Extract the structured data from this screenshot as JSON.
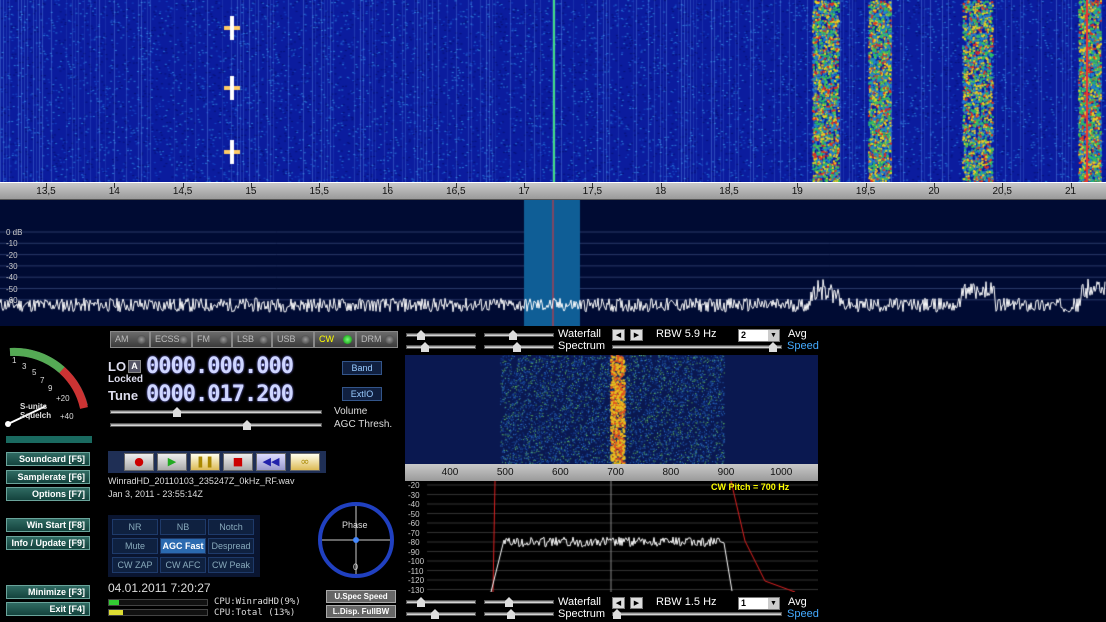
{
  "top_axis": {
    "labels": [
      "13,5",
      "14",
      "14,5",
      "15",
      "15,5",
      "16",
      "16,5",
      "17",
      "17,5",
      "18",
      "18,5",
      "19",
      "19,5",
      "20",
      "20,5",
      "21"
    ]
  },
  "top_spectrum": {
    "db_labels": [
      "0 dB",
      "-10",
      "-20",
      "-30",
      "-40",
      "-50",
      "-60"
    ]
  },
  "modes": [
    {
      "label": "AM",
      "active": false
    },
    {
      "label": "ECSS",
      "active": false
    },
    {
      "label": "FM",
      "active": false
    },
    {
      "label": "LSB",
      "active": false
    },
    {
      "label": "USB",
      "active": false
    },
    {
      "label": "CW",
      "active": true
    },
    {
      "label": "DRM",
      "active": false
    }
  ],
  "lo": {
    "label": "LO",
    "badge": "A",
    "locked": "Locked",
    "value": "0000.000.000"
  },
  "tune": {
    "label": "Tune",
    "value": "0000.017.200"
  },
  "band_button": "Band",
  "extio_button": "ExtIO",
  "volume_label": "Volume",
  "agc_label": "AGC Thresh.",
  "smeter": {
    "scale": [
      "1",
      "3",
      "5",
      "7",
      "9",
      "+20",
      "+40"
    ],
    "caption1": "S-units",
    "caption2": "Squelch"
  },
  "left_buttons": [
    {
      "label": "Soundcard  [F5]"
    },
    {
      "label": "Samplerate  [F6]"
    },
    {
      "label": "Options  [F7]"
    },
    {
      "label": "Win Start  [F8]"
    },
    {
      "label": "Info / Update  [F9]"
    },
    {
      "label": "Minimize  [F3]"
    },
    {
      "label": "Exit  [F4]"
    }
  ],
  "file": {
    "name": "WinradHD_20110103_235247Z_0kHz_RF.wav",
    "date": "Jan 3, 2011 - 23:55:14Z"
  },
  "dsp_buttons": [
    {
      "label": "NR",
      "on": false
    },
    {
      "label": "NB",
      "on": false
    },
    {
      "label": "Notch",
      "on": false
    },
    {
      "label": "Mute",
      "on": false
    },
    {
      "label": "AGC Fast",
      "on": true
    },
    {
      "label": "Despread",
      "on": false
    },
    {
      "label": "CW ZAP",
      "on": false
    },
    {
      "label": "CW AFC",
      "on": false
    },
    {
      "label": "CW Peak",
      "on": false
    }
  ],
  "phase": {
    "label": "Phase",
    "value": "0"
  },
  "clock": "04.01.2011 7:20:27",
  "cpu": {
    "app_label": "CPU:WinradHD",
    "app_pct": "(9%)",
    "total_label": "CPU:Total",
    "total_pct": "(13%)"
  },
  "uspec_button": "U.Spec Speed",
  "ldisp_button": "L.Disp. FullBW",
  "top_controls": {
    "waterfall": "Waterfall",
    "spectrum": "Spectrum",
    "rbw": "RBW  5.9 Hz",
    "avg_value": "2",
    "avg": "Avg",
    "speed": "Speed"
  },
  "bottom_controls": {
    "waterfall": "Waterfall",
    "spectrum": "Spectrum",
    "rbw": "RBW  1.5 Hz",
    "avg_value": "1",
    "avg": "Avg",
    "speed": "Speed"
  },
  "zoom_axis": {
    "labels": [
      "400",
      "500",
      "600",
      "700",
      "800",
      "900",
      "1000"
    ]
  },
  "zoom_spectrum": {
    "db_labels": [
      "-20",
      "-30",
      "-40",
      "-50",
      "-60",
      "-70",
      "-80",
      "-90",
      "-100",
      "-110",
      "-120",
      "-130"
    ],
    "cw_pitch": "CW Pitch = 700 Hz"
  },
  "colors": {
    "wf_bg": "#0a1aa0",
    "spec_bg": "#000033",
    "accent": "#4af"
  }
}
